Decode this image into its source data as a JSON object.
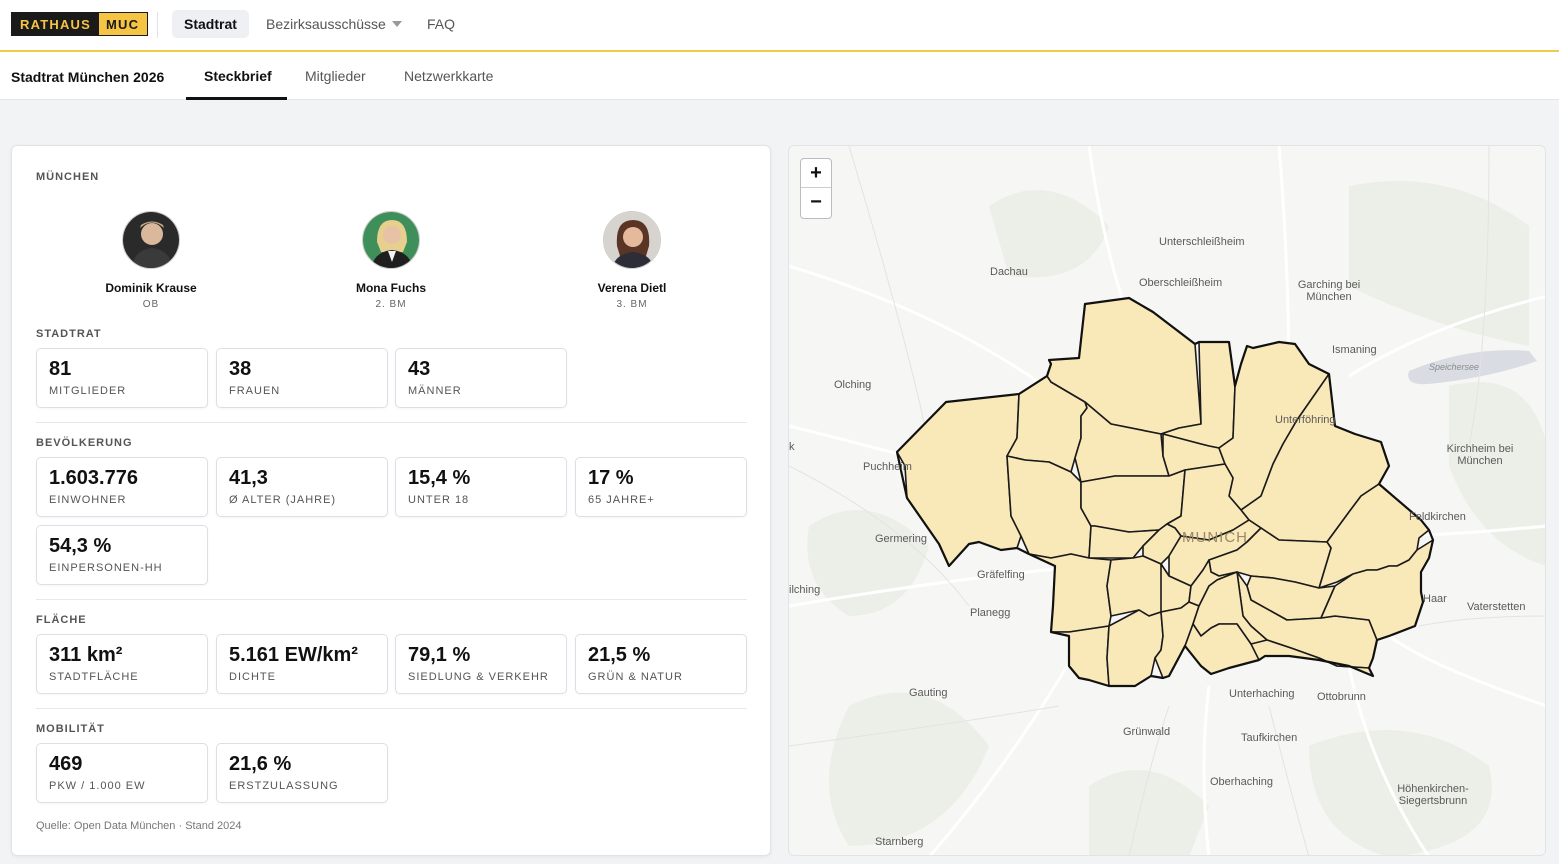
{
  "app": {
    "logo_left": "RATHAUS",
    "logo_right": "MUC",
    "nav": [
      "Stadtrat",
      "Bezirksausschüsse",
      "FAQ"
    ]
  },
  "subnav": {
    "title": "Stadtrat München 2026",
    "tabs": [
      "Steckbrief",
      "Mitglieder",
      "Netzwerkkarte"
    ]
  },
  "profile": {
    "city": "MÜNCHEN",
    "people": [
      {
        "name": "Dominik Krause",
        "role": "OB"
      },
      {
        "name": "Mona Fuchs",
        "role": "2. BM"
      },
      {
        "name": "Verena Dietl",
        "role": "3. BM"
      }
    ],
    "sections": {
      "stadtrat": {
        "label": "STADTRAT",
        "stats": [
          {
            "value": "81",
            "label": "MITGLIEDER"
          },
          {
            "value": "38",
            "label": "FRAUEN"
          },
          {
            "value": "43",
            "label": "MÄNNER"
          }
        ]
      },
      "bevoelkerung": {
        "label": "BEVÖLKERUNG",
        "stats": [
          {
            "value": "1.603.776",
            "label": "EINWOHNER"
          },
          {
            "value": "41,3",
            "label": "Ø ALTER (JAHRE)"
          },
          {
            "value": "15,4 %",
            "label": "UNTER 18"
          },
          {
            "value": "17 %",
            "label": "65 JAHRE+"
          },
          {
            "value": "54,3 %",
            "label": "EINPERSONEN-HH"
          }
        ]
      },
      "flaeche": {
        "label": "FLÄCHE",
        "stats": [
          {
            "value": "311 km²",
            "label": "STADTFLÄCHE"
          },
          {
            "value": "5.161 EW/km²",
            "label": "DICHTE"
          },
          {
            "value": "79,1 %",
            "label": "SIEDLUNG & VERKEHR"
          },
          {
            "value": "21,5 %",
            "label": "GRÜN & NATUR"
          }
        ]
      },
      "mobilitaet": {
        "label": "MOBILITÄT",
        "stats": [
          {
            "value": "469",
            "label": "PKW / 1.000 EW"
          },
          {
            "value": "21,6 %",
            "label": "ERSTZULASSUNG"
          }
        ]
      }
    },
    "source": "Quelle: Open Data München · Stand 2024"
  },
  "map": {
    "zoom_in": "+",
    "zoom_out": "−",
    "labels": {
      "unterschleissheim": "Unterschleißheim",
      "dachau": "Dachau",
      "oberschleissheim": "Oberschleißheim",
      "garching": "Garching bei München",
      "ismaning": "Ismaning",
      "speichersee": "Speichersee",
      "olching": "Olching",
      "unterfoehring": "Unterföhring",
      "k": "k",
      "puchheim": "Puchheim",
      "kirchheim": "Kirchheim bei München",
      "germering": "Germering",
      "munich": "MUNICH",
      "feldkirchen": "Feldkirchen",
      "graefelfing": "Gräfelfing",
      "ilching": "ilching",
      "haar": "Haar",
      "planegg": "Planegg",
      "vaterstetten": "Vaterstetten",
      "gauting": "Gauting",
      "unterhaching": "Unterhaching",
      "ottobrunn": "Ottobrunn",
      "gruenwald": "Grünwald",
      "taufkirchen": "Taufkirchen",
      "oberhaching": "Oberhaching",
      "hoehenkirchen": "Höhenkirchen-Siegertsbrunn",
      "starnberg": "Starnberg"
    },
    "colors": {
      "district_fill": "#f9e8b8",
      "district_stroke": "#1a1a1a",
      "road": "#ffffff",
      "green": "#eceee8"
    }
  }
}
